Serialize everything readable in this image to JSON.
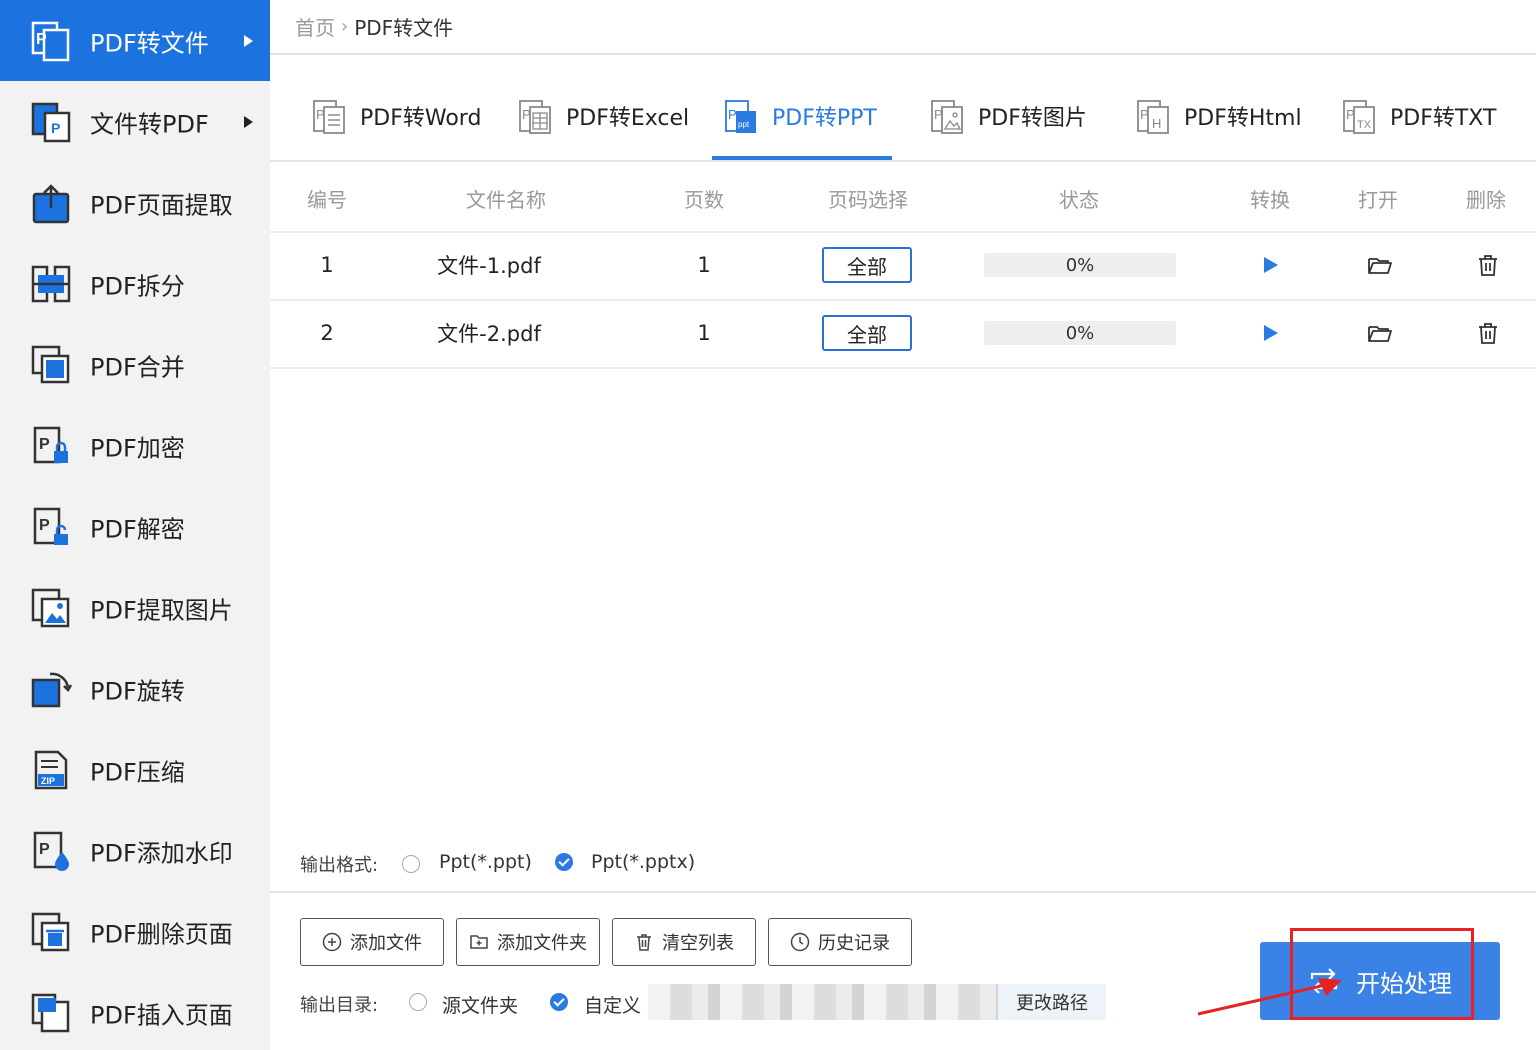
{
  "sidebar": {
    "items": [
      {
        "label": "PDF转文件",
        "active": true,
        "arrow": true
      },
      {
        "label": "文件转PDF",
        "active": false,
        "arrow": true
      },
      {
        "label": "PDF页面提取",
        "active": false,
        "arrow": false
      },
      {
        "label": "PDF拆分",
        "active": false,
        "arrow": false
      },
      {
        "label": "PDF合并",
        "active": false,
        "arrow": false
      },
      {
        "label": "PDF加密",
        "active": false,
        "arrow": false
      },
      {
        "label": "PDF解密",
        "active": false,
        "arrow": false
      },
      {
        "label": "PDF提取图片",
        "active": false,
        "arrow": false
      },
      {
        "label": "PDF旋转",
        "active": false,
        "arrow": false
      },
      {
        "label": "PDF压缩",
        "active": false,
        "arrow": false
      },
      {
        "label": "PDF添加水印",
        "active": false,
        "arrow": false
      },
      {
        "label": "PDF删除页面",
        "active": false,
        "arrow": false
      },
      {
        "label": "PDF插入页面",
        "active": false,
        "arrow": false
      }
    ]
  },
  "breadcrumb": {
    "home": "首页",
    "separator": "›",
    "current": "PDF转文件"
  },
  "tabs": [
    {
      "label": "PDF转Word",
      "icon": "word-doc-icon"
    },
    {
      "label": "PDF转Excel",
      "icon": "excel-doc-icon"
    },
    {
      "label": "PDF转PPT",
      "icon": "ppt-doc-icon",
      "active": true
    },
    {
      "label": "PDF转图片",
      "icon": "image-doc-icon"
    },
    {
      "label": "PDF转Html",
      "icon": "html-doc-icon"
    },
    {
      "label": "PDF转TXT",
      "icon": "txt-doc-icon"
    }
  ],
  "table": {
    "headers": [
      "编号",
      "文件名称",
      "页数",
      "页码选择",
      "状态",
      "转换",
      "打开",
      "删除"
    ],
    "rows": [
      {
        "index": "1",
        "filename": "文件-1.pdf",
        "pages": "1",
        "page_select": "全部",
        "status": "0%",
        "progress": 0
      },
      {
        "index": "2",
        "filename": "文件-2.pdf",
        "pages": "1",
        "page_select": "全部",
        "status": "0%",
        "progress": 0
      }
    ]
  },
  "output_format": {
    "label": "输出格式:",
    "options": [
      {
        "label": "Ppt(*.ppt)",
        "checked": false
      },
      {
        "label": "Ppt(*.pptx)",
        "checked": true
      }
    ]
  },
  "toolbar": {
    "add_file": "添加文件",
    "add_folder": "添加文件夹",
    "clear_list": "清空列表",
    "history": "历史记录"
  },
  "output_dir": {
    "label": "输出目录:",
    "options": [
      {
        "label": "源文件夹",
        "checked": false
      },
      {
        "label": "自定义",
        "checked": true
      }
    ],
    "change_path": "更改路径"
  },
  "start_button": {
    "label": "开始处理"
  },
  "colors": {
    "accent": "#1c73e0",
    "button_blue": "#3b82e6",
    "highlight_red": "#e82222"
  }
}
